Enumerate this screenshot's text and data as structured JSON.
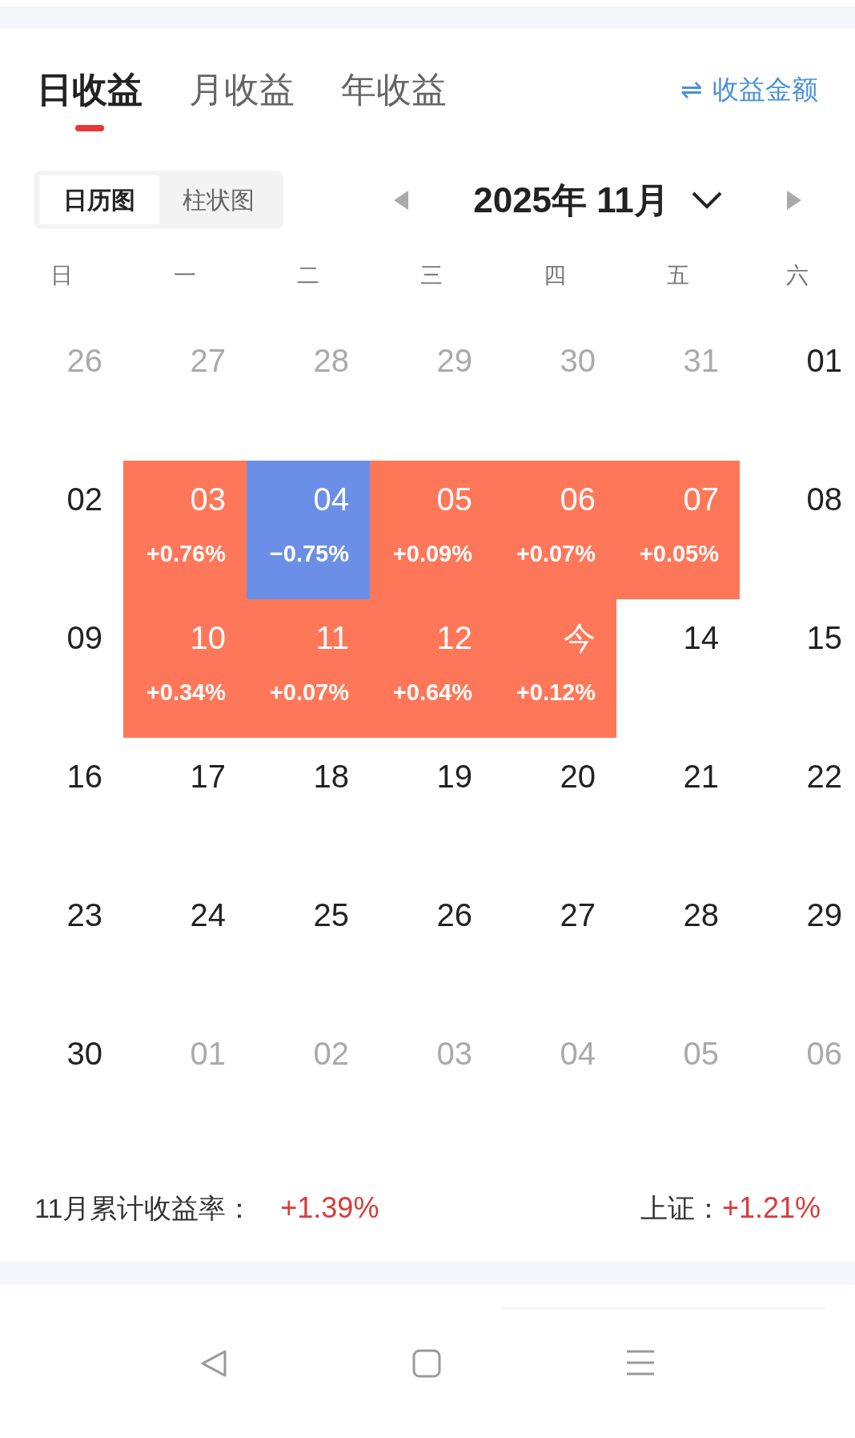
{
  "tabs": [
    {
      "label": "日收益",
      "selected": true
    },
    {
      "label": "月收益",
      "selected": false
    },
    {
      "label": "年收益",
      "selected": false
    }
  ],
  "toggle": {
    "icon": "⇌",
    "label": "收益金额"
  },
  "views": [
    {
      "label": "日历图",
      "selected": true
    },
    {
      "label": "柱状图",
      "selected": false
    }
  ],
  "month": {
    "label": "2025年 11月"
  },
  "weekdays": [
    "日",
    "一",
    "二",
    "三",
    "四",
    "五",
    "六"
  ],
  "days": [
    {
      "label": "26",
      "kind": "other"
    },
    {
      "label": "27",
      "kind": "other"
    },
    {
      "label": "28",
      "kind": "other"
    },
    {
      "label": "29",
      "kind": "other"
    },
    {
      "label": "30",
      "kind": "other"
    },
    {
      "label": "31",
      "kind": "other"
    },
    {
      "label": "01",
      "kind": "plain"
    },
    {
      "label": "02",
      "kind": "plain"
    },
    {
      "label": "03",
      "kind": "gain",
      "pct": "+0.76%"
    },
    {
      "label": "04",
      "kind": "loss",
      "pct": "−0.75%"
    },
    {
      "label": "05",
      "kind": "gain",
      "pct": "+0.09%"
    },
    {
      "label": "06",
      "kind": "gain",
      "pct": "+0.07%"
    },
    {
      "label": "07",
      "kind": "gain",
      "pct": "+0.05%"
    },
    {
      "label": "08",
      "kind": "plain"
    },
    {
      "label": "09",
      "kind": "plain"
    },
    {
      "label": "10",
      "kind": "gain",
      "pct": "+0.34%"
    },
    {
      "label": "11",
      "kind": "gain",
      "pct": "+0.07%"
    },
    {
      "label": "12",
      "kind": "gain",
      "pct": "+0.64%"
    },
    {
      "label": "今",
      "kind": "gain",
      "pct": "+0.12%"
    },
    {
      "label": "14",
      "kind": "plain"
    },
    {
      "label": "15",
      "kind": "plain"
    },
    {
      "label": "16",
      "kind": "plain"
    },
    {
      "label": "17",
      "kind": "plain"
    },
    {
      "label": "18",
      "kind": "plain"
    },
    {
      "label": "19",
      "kind": "plain"
    },
    {
      "label": "20",
      "kind": "plain"
    },
    {
      "label": "21",
      "kind": "plain"
    },
    {
      "label": "22",
      "kind": "plain"
    },
    {
      "label": "23",
      "kind": "plain"
    },
    {
      "label": "24",
      "kind": "plain"
    },
    {
      "label": "25",
      "kind": "plain"
    },
    {
      "label": "26",
      "kind": "plain"
    },
    {
      "label": "27",
      "kind": "plain"
    },
    {
      "label": "28",
      "kind": "plain"
    },
    {
      "label": "29",
      "kind": "plain"
    },
    {
      "label": "30",
      "kind": "plain"
    },
    {
      "label": "01",
      "kind": "other"
    },
    {
      "label": "02",
      "kind": "other"
    },
    {
      "label": "03",
      "kind": "other"
    },
    {
      "label": "04",
      "kind": "other"
    },
    {
      "label": "05",
      "kind": "other"
    },
    {
      "label": "06",
      "kind": "other"
    }
  ],
  "summary": {
    "label": "11月累计收益率：",
    "value": "+1.39%",
    "index_label": "上证：",
    "index_value": "+1.21%"
  }
}
